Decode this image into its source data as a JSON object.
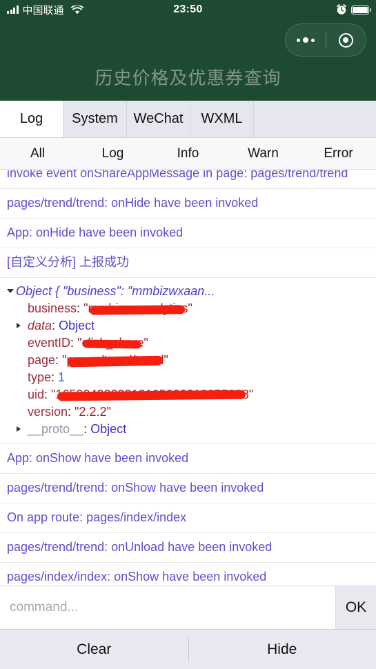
{
  "statusbar": {
    "carrier": "中国联通",
    "time": "23:50",
    "signal_icon": "signal-bars-icon",
    "wifi_icon": "wifi-icon",
    "alarm_icon": "alarm-clock-icon",
    "battery_icon": "battery-icon"
  },
  "header": {
    "background_color": "#1e4a32",
    "page_title": "历史价格及优惠券查询",
    "capsule": {
      "menu_icon": "more-dots-icon",
      "target_icon": "close-target-icon"
    }
  },
  "tabs": [
    {
      "label": "Log",
      "active": true
    },
    {
      "label": "System",
      "active": false
    },
    {
      "label": "WeChat",
      "active": false
    },
    {
      "label": "WXML",
      "active": false
    }
  ],
  "filters": [
    {
      "label": "All",
      "active": true
    },
    {
      "label": "Log",
      "active": false
    },
    {
      "label": "Info",
      "active": false
    },
    {
      "label": "Warn",
      "active": false
    },
    {
      "label": "Error",
      "active": false
    }
  ],
  "log": {
    "text_color": "#5c50d0",
    "entries": [
      {
        "type": "text",
        "text": "invoke event onShareAppMessage in page: pages/trend/trend",
        "clipped_top": true
      },
      {
        "type": "text",
        "text": "pages/trend/trend: onHide have been invoked"
      },
      {
        "type": "text",
        "text": "App: onHide have been invoked"
      },
      {
        "type": "text",
        "text": "[自定义分析] 上报成功"
      },
      {
        "type": "object",
        "header": "Object { \"business\": \"mmbizwxaan...",
        "properties": [
          {
            "key": "business",
            "value": "\"mmbizwxanalytics\"",
            "value_kind": "string",
            "redacted": true,
            "expandable": false
          },
          {
            "key": "data",
            "value": "Object",
            "value_kind": "object",
            "redacted": false,
            "expandable": true,
            "key_italic_colon": true
          },
          {
            "key": "eventID",
            "value": "\"click_share\"",
            "value_kind": "string",
            "redacted": true,
            "expandable": false
          },
          {
            "key": "page",
            "value": "\"pages/trend/trend\"",
            "value_kind": "string",
            "redacted": true,
            "expandable": false
          },
          {
            "key": "type",
            "value": "1",
            "value_kind": "number",
            "redacted": false,
            "expandable": false
          },
          {
            "key": "uid",
            "value": "\"1650049202210105000012055008\"",
            "value_kind": "string",
            "redacted": true,
            "expandable": false
          },
          {
            "key": "version",
            "value": "\"2.2.2\"",
            "value_kind": "string",
            "redacted": false,
            "expandable": false
          },
          {
            "key": "__proto__",
            "value": "Object",
            "value_kind": "object",
            "redacted": false,
            "expandable": true,
            "is_proto": true
          }
        ]
      },
      {
        "type": "text",
        "text": "App: onShow have been invoked"
      },
      {
        "type": "text",
        "text": "pages/trend/trend: onShow have been invoked"
      },
      {
        "type": "text",
        "text": "On app route: pages/index/index"
      },
      {
        "type": "text",
        "text": "pages/trend/trend: onUnload have been invoked"
      },
      {
        "type": "text",
        "text": "pages/index/index: onShow have been invoked"
      }
    ]
  },
  "command": {
    "value": "",
    "placeholder": "command...",
    "ok_label": "OK"
  },
  "footer": {
    "clear_label": "Clear",
    "hide_label": "Hide"
  }
}
